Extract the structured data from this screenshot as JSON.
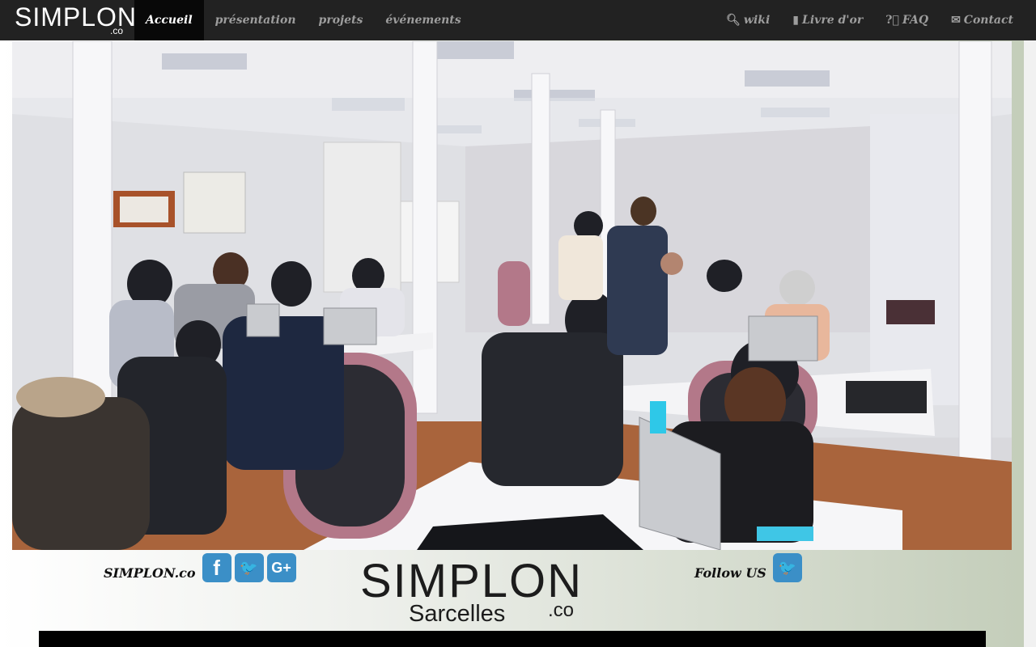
{
  "brand": {
    "wordmark": "SIMPLON",
    "suffix": ".co"
  },
  "nav": {
    "left": [
      {
        "label": "Accueil",
        "active": true
      },
      {
        "label": "présentation",
        "active": false
      },
      {
        "label": "projets",
        "active": false
      },
      {
        "label": "événements",
        "active": false
      }
    ],
    "right": [
      {
        "label": "wiki",
        "icon": "search-icon"
      },
      {
        "label": "Livre d'or",
        "icon": "book-icon"
      },
      {
        "label": "FAQ",
        "icon": "question-circle-icon"
      },
      {
        "label": "Contact",
        "icon": "envelope-icon"
      }
    ]
  },
  "hero": {
    "image": "classroom-photo"
  },
  "footer": {
    "left_text": "SIMPLON.co",
    "social": [
      {
        "icon": "facebook-icon",
        "glyph": "f"
      },
      {
        "icon": "twitter-icon",
        "glyph": "🐦"
      },
      {
        "icon": "google-plus-icon",
        "glyph": "G+"
      }
    ],
    "logo": {
      "word": "SIMPLON",
      "sub": "Sarcelles",
      "suffix": ".co"
    },
    "follow_text": "Follow US",
    "follow_icon": "twitter-icon"
  },
  "colors": {
    "navbar": "#222222",
    "nav_active": "#080808",
    "social_button": "#3b8fc7",
    "logo_accent": "#d0202e"
  }
}
